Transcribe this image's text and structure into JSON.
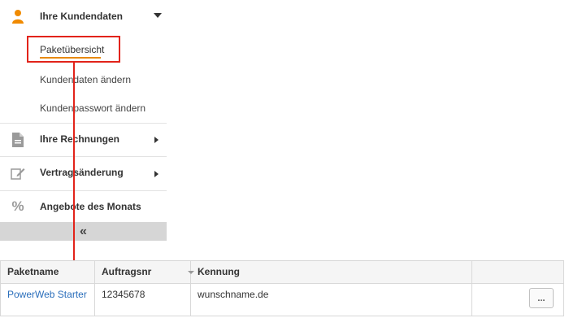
{
  "sidebar": {
    "kundendaten": {
      "label": "Ihre Kundendaten",
      "icon": "user-icon",
      "subitems": [
        "Paketübersicht",
        "Kundendaten ändern",
        "Kundenpasswort ändern"
      ]
    },
    "rechnungen": {
      "label": "Ihre Rechnungen",
      "icon": "document-icon"
    },
    "vertrag": {
      "label": "Vertragsänderung",
      "icon": "edit-icon"
    },
    "angebote": {
      "label": "Angebote des Monats",
      "icon": "percent-icon"
    },
    "collapse_label": "«"
  },
  "table": {
    "headers": [
      "Paketname",
      "Auftragsnr",
      "Kennung",
      ""
    ],
    "rows": [
      {
        "paketname": "PowerWeb Starter",
        "auftragsnr": "12345678",
        "kennung": "wunschname.de",
        "action": "..."
      }
    ]
  },
  "colors": {
    "accent_orange": "#e8890c",
    "highlight_red": "#e2231a",
    "link_blue": "#2a6ebb"
  }
}
